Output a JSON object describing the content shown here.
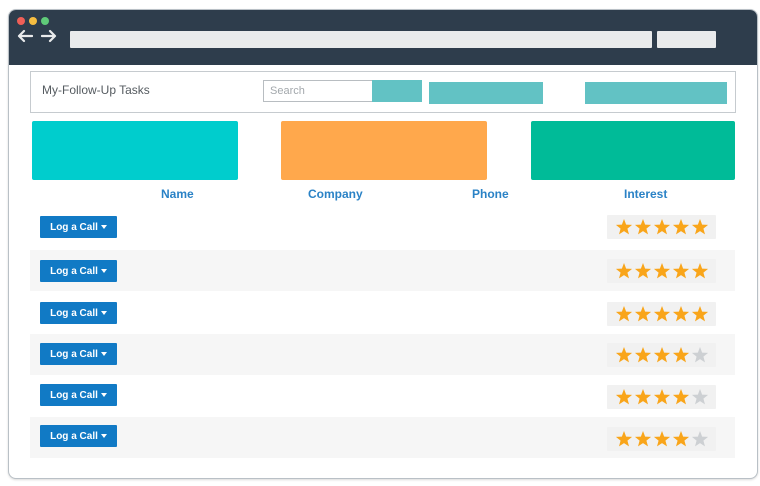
{
  "header": {
    "title": "My-Follow-Up Tasks",
    "search_placeholder": "Search"
  },
  "columns": {
    "name": "Name",
    "company": "Company",
    "phone": "Phone",
    "interest": "Interest"
  },
  "colors": {
    "titlebar": "#2e3d4c",
    "card_1": "#00cdcd",
    "card_2": "#ffa84c",
    "card_3": "#00bb98",
    "accent_button": "#62c2c4",
    "log_button": "#117ac5",
    "header_text": "#2a82c6",
    "star_filled": "#f9a51a",
    "star_empty": "#cdd0d3"
  },
  "rows": [
    {
      "button_label": "Log a Call",
      "rating": 5,
      "max_rating": 5
    },
    {
      "button_label": "Log a Call",
      "rating": 5,
      "max_rating": 5
    },
    {
      "button_label": "Log a Call",
      "rating": 5,
      "max_rating": 5
    },
    {
      "button_label": "Log a Call",
      "rating": 4,
      "max_rating": 5
    },
    {
      "button_label": "Log a Call",
      "rating": 4,
      "max_rating": 5
    },
    {
      "button_label": "Log a Call",
      "rating": 4,
      "max_rating": 5
    }
  ]
}
